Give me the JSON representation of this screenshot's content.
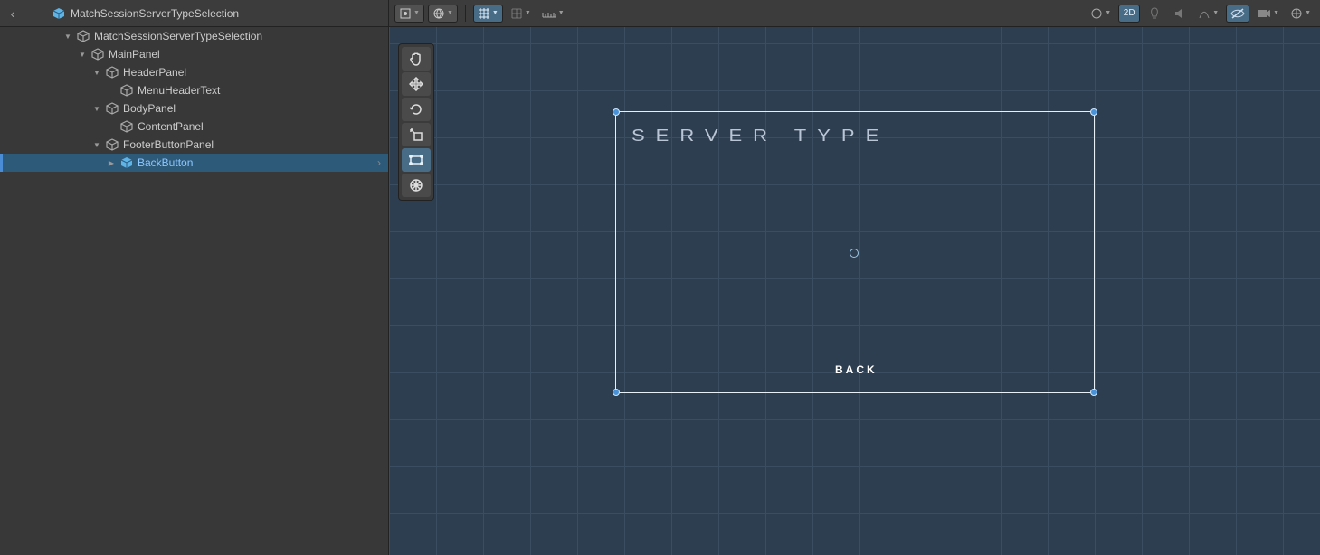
{
  "header": {
    "prefab_name": "MatchSessionServerTypeSelection"
  },
  "toolbar": {
    "btn_2d": "2D"
  },
  "hierarchy": {
    "items": [
      {
        "label": "MatchSessionServerTypeSelection",
        "depth": 0,
        "arrow": "down",
        "icon": "outline",
        "selected": false
      },
      {
        "label": "MainPanel",
        "depth": 1,
        "arrow": "down",
        "icon": "outline",
        "selected": false
      },
      {
        "label": "HeaderPanel",
        "depth": 2,
        "arrow": "down",
        "icon": "outline",
        "selected": false
      },
      {
        "label": "MenuHeaderText",
        "depth": 3,
        "arrow": "",
        "icon": "outline",
        "selected": false
      },
      {
        "label": "BodyPanel",
        "depth": 2,
        "arrow": "down",
        "icon": "outline",
        "selected": false
      },
      {
        "label": "ContentPanel",
        "depth": 3,
        "arrow": "",
        "icon": "outline",
        "selected": false
      },
      {
        "label": "FooterButtonPanel",
        "depth": 2,
        "arrow": "down",
        "icon": "outline",
        "selected": false
      },
      {
        "label": "BackButton",
        "depth": 3,
        "arrow": "right",
        "icon": "prefab",
        "selected": true
      }
    ]
  },
  "scene": {
    "title_text": "SERVER TYPE",
    "back_text": "BACK"
  }
}
